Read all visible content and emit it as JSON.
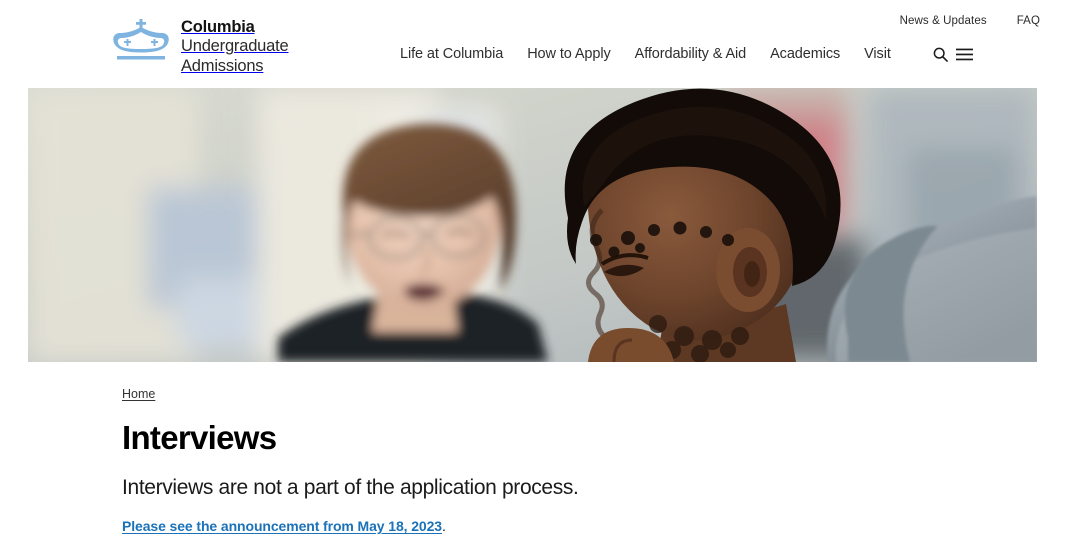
{
  "header": {
    "brand": {
      "logo_icon": "columbia-crown-icon",
      "line1": "Columbia",
      "line2": "Undergraduate",
      "line3": "Admissions",
      "logo_color": "#7fb4e0"
    },
    "utility_nav": [
      {
        "label": "News & Updates"
      },
      {
        "label": "FAQ"
      }
    ],
    "main_nav": [
      {
        "label": "Life at Columbia"
      },
      {
        "label": "How to Apply"
      },
      {
        "label": "Affordability & Aid"
      },
      {
        "label": "Academics"
      },
      {
        "label": "Visit"
      }
    ],
    "tools": [
      {
        "icon": "search-icon",
        "label": "Search"
      },
      {
        "icon": "hamburger-menu-icon",
        "label": "Menu"
      }
    ]
  },
  "hero": {
    "alt": "Blurred woman with glasses speaking on the left and a young man in a gray hoodie listening in focus on the right"
  },
  "content": {
    "breadcrumb": "Home",
    "title": "Interviews",
    "lede": "Interviews are not a part of the application process.",
    "announcement_link": "Please see the announcement from May 18, 2023",
    "announcement_suffix": "."
  },
  "colors": {
    "link_blue": "#1b72b8",
    "text_dark": "#1b1b1b",
    "crown_blue": "#7fb4e0"
  }
}
